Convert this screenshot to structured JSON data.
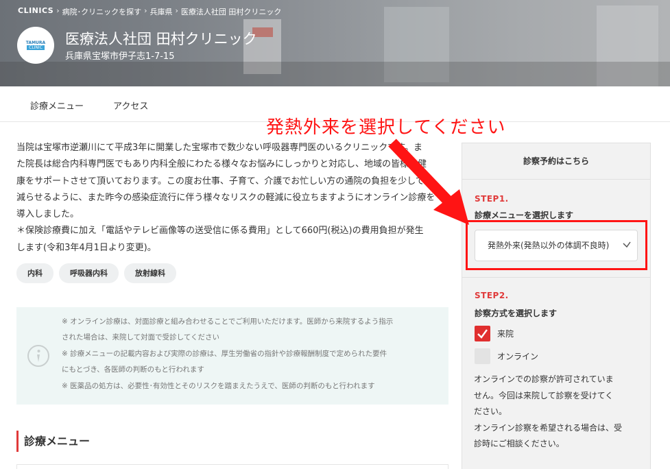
{
  "breadcrumb": {
    "items": [
      "CLINICS",
      "病院･クリニックを探す",
      "兵庫県",
      "医療法人社団 田村クリニック"
    ],
    "separator": "›"
  },
  "clinic": {
    "logo_line1": "TAMURA",
    "logo_line2": "CLINIC",
    "name": "医療法人社団 田村クリニック",
    "address": "兵庫県宝塚市伊子志1-7-15"
  },
  "nav": {
    "tabs": [
      {
        "label": "診療メニュー"
      },
      {
        "label": "アクセス"
      }
    ]
  },
  "annotation": {
    "text": "発熱外来を選択してください",
    "color": "#ff1414"
  },
  "description": {
    "lines": [
      "当院は宝塚市逆瀬川にて平成3年に開業した宝塚市で数少ない呼吸器専門医のいるクリニックです。ま",
      "た院長は総合内科専門医でもあり内科全般にわたる様々なお悩みにしっかりと対応し、地域の皆様の健",
      "康をサポートさせて頂いております。この度お仕事、子育て、介護でお忙しい方の通院の負担を少しでも",
      "減らせるように、また昨今の感染症流行に伴う様々なリスクの軽減に役立ちますようにオンライン診療を",
      "導入しました。",
      "＊保険診療費に加え「電話やテレビ画像等の送受信に係る費用」として660円(税込)の費用負担が発生",
      "します(令和3年4月1日より変更)。"
    ]
  },
  "tags": [
    "内科",
    "呼吸器内科",
    "放射線科"
  ],
  "notice": {
    "lines": [
      "※ オンライン診療は、対面診療と組み合わせることでご利用いただけます。医師から来院するよう指示",
      "された場合は、来院して対面で受診してください",
      "※ 診療メニューの記載内容および実際の診療は、厚生労働省の指針や診療報酬制度で定められた要件",
      "にもとづき、各医師の判断のもと行われます",
      "※ 医薬品の処方は、必要性･有効性とそのリスクを踏まえたうえで、医師の判断のもと行われます"
    ]
  },
  "menu_section": {
    "title": "診療メニュー"
  },
  "reservation": {
    "heading": "診察予約はこちら",
    "step1": {
      "label": "STEP1.",
      "title": "診療メニューを選択します",
      "selected": "発熱外来(発熱以外の体調不良時)"
    },
    "step2": {
      "label": "STEP2.",
      "title": "診察方式を選択します",
      "options": [
        {
          "label": "来院",
          "checked": true
        },
        {
          "label": "オンライン",
          "checked": false
        }
      ]
    },
    "note_lines": [
      "オンラインでの診察が許可されていま",
      "せん。今回は来院して診察を受けてく",
      "ださい。",
      "オンライン診察を希望される場合は、受",
      "診時にご相談ください。"
    ]
  },
  "colors": {
    "accent": "#e03a3a",
    "checkbox_on": "#e02f2f",
    "notice_bg": "#eef6f5"
  }
}
